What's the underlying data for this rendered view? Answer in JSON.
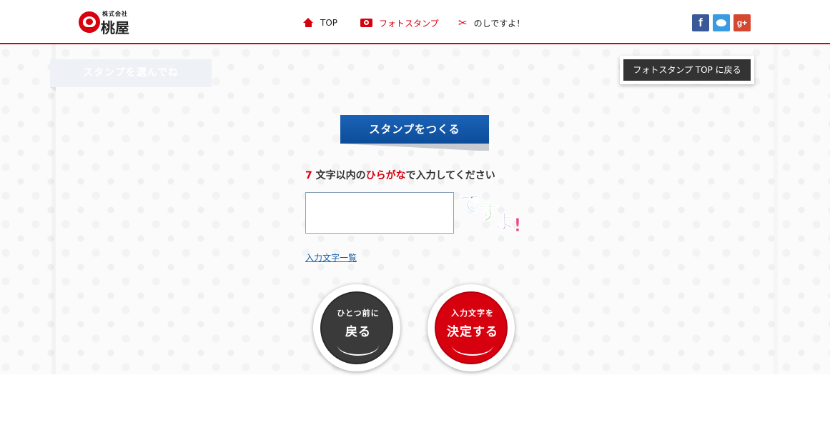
{
  "header": {
    "logo_sub": "株式会社",
    "logo_name": "桃屋",
    "nav": [
      {
        "label": "TOP"
      },
      {
        "label": "フォトスタンプ"
      },
      {
        "label": "のしですよ！"
      }
    ],
    "social": {
      "facebook": "f",
      "google_plus": "g+"
    }
  },
  "sidebar": {
    "tab_label": "スタンプを選んでね"
  },
  "back_top_button": "フォトスタンプ TOP に戻る",
  "main": {
    "ribbon_title": "スタンプをつくる",
    "instruction": {
      "part1": "7",
      "part2": " 文字以内の",
      "part3": "ひらがな",
      "part4": "で入力してください"
    },
    "input_value": "",
    "desuyo_image_text": "ですよ!",
    "char_list_link": "入力文字一覧",
    "back_button": {
      "small": "ひとつ前に",
      "big": "戻る"
    },
    "confirm_button": {
      "small": "入力文字を",
      "big": "決定する"
    }
  },
  "colors": {
    "brand_red": "#d7000f",
    "ribbon_blue": "#0d4d9a",
    "dark_button": "#3a3a3a"
  }
}
